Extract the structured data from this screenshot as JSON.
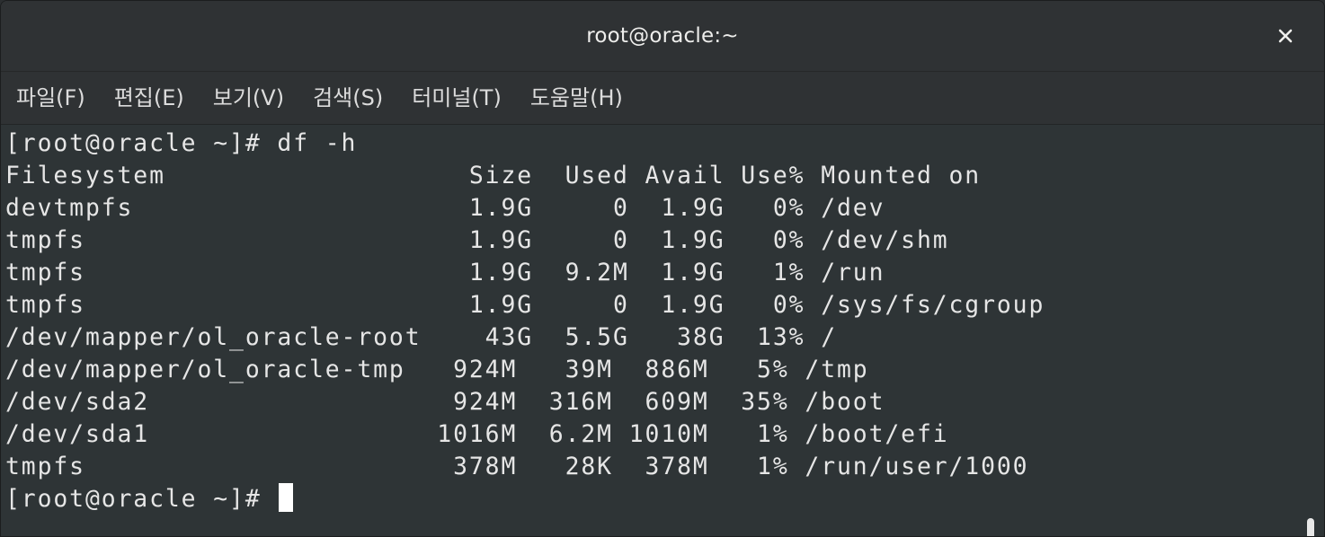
{
  "window": {
    "title": "root@oracle:~"
  },
  "menu": {
    "items": [
      {
        "label": "파일(F)"
      },
      {
        "label": "편집(E)"
      },
      {
        "label": "보기(V)"
      },
      {
        "label": "검색(S)"
      },
      {
        "label": "터미널(T)"
      },
      {
        "label": "도움말(H)"
      }
    ]
  },
  "terminal": {
    "lines": [
      "[root@oracle ~]# df -h",
      "Filesystem                   Size  Used Avail Use% Mounted on",
      "devtmpfs                     1.9G     0  1.9G   0% /dev",
      "tmpfs                        1.9G     0  1.9G   0% /dev/shm",
      "tmpfs                        1.9G  9.2M  1.9G   1% /run",
      "tmpfs                        1.9G     0  1.9G   0% /sys/fs/cgroup",
      "/dev/mapper/ol_oracle-root    43G  5.5G   38G  13% /",
      "/dev/mapper/ol_oracle-tmp   924M   39M  886M   5% /tmp",
      "/dev/sda2                   924M  316M  609M  35% /boot",
      "/dev/sda1                  1016M  6.2M 1010M   1% /boot/efi",
      "tmpfs                       378M   28K  378M   1% /run/user/1000"
    ],
    "prompt": "[root@oracle ~]# "
  },
  "colors": {
    "background": "#2e3436",
    "titlebar": "#2f3234",
    "text": "#e6e6e6",
    "cursor": "#ffffff"
  },
  "icons": {
    "close": "close-icon"
  }
}
